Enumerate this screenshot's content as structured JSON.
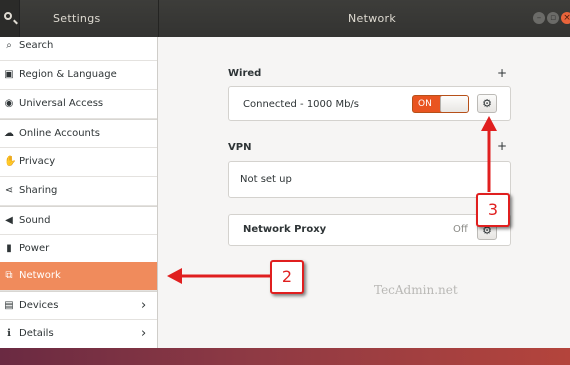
{
  "header": {
    "left_title": "Settings",
    "right_title": "Network",
    "window_buttons": [
      "minimize-icon",
      "maximize-icon",
      "close-icon"
    ]
  },
  "sidebar": {
    "items": [
      {
        "label": "Search",
        "icon": "search-icon",
        "glyph": "⌕"
      },
      {
        "label": "Region & Language",
        "icon": "region-icon",
        "glyph": "▣"
      },
      {
        "label": "Universal Access",
        "icon": "accessibility-icon",
        "glyph": "◉"
      },
      {
        "label": "Online Accounts",
        "icon": "online-accounts-icon",
        "glyph": "☁"
      },
      {
        "label": "Privacy",
        "icon": "privacy-hand-icon",
        "glyph": "✋"
      },
      {
        "label": "Sharing",
        "icon": "share-icon",
        "glyph": "⋖"
      },
      {
        "label": "Sound",
        "icon": "speaker-icon",
        "glyph": "◀"
      },
      {
        "label": "Power",
        "icon": "power-icon",
        "glyph": "▮"
      },
      {
        "label": "Network",
        "icon": "network-icon",
        "glyph": "⧉"
      },
      {
        "label": "Devices",
        "icon": "devices-icon",
        "glyph": "▤"
      },
      {
        "label": "Details",
        "icon": "info-icon",
        "glyph": "ℹ"
      }
    ],
    "active": "Network",
    "accent_color": "#f08b5c"
  },
  "main": {
    "wired": {
      "title": "Wired",
      "add_label": "+",
      "connection_label": "Connected - 1000 Mb/s",
      "switch_label": "ON",
      "switch_color": "#e95420"
    },
    "vpn": {
      "title": "VPN",
      "add_label": "+",
      "status": "Not set up"
    },
    "proxy": {
      "label": "Network Proxy",
      "status": "Off"
    }
  },
  "annotations": {
    "callout_2": "2",
    "callout_3": "3",
    "arrow_color": "#e01f1f"
  },
  "watermark": "TecAdmin.net"
}
